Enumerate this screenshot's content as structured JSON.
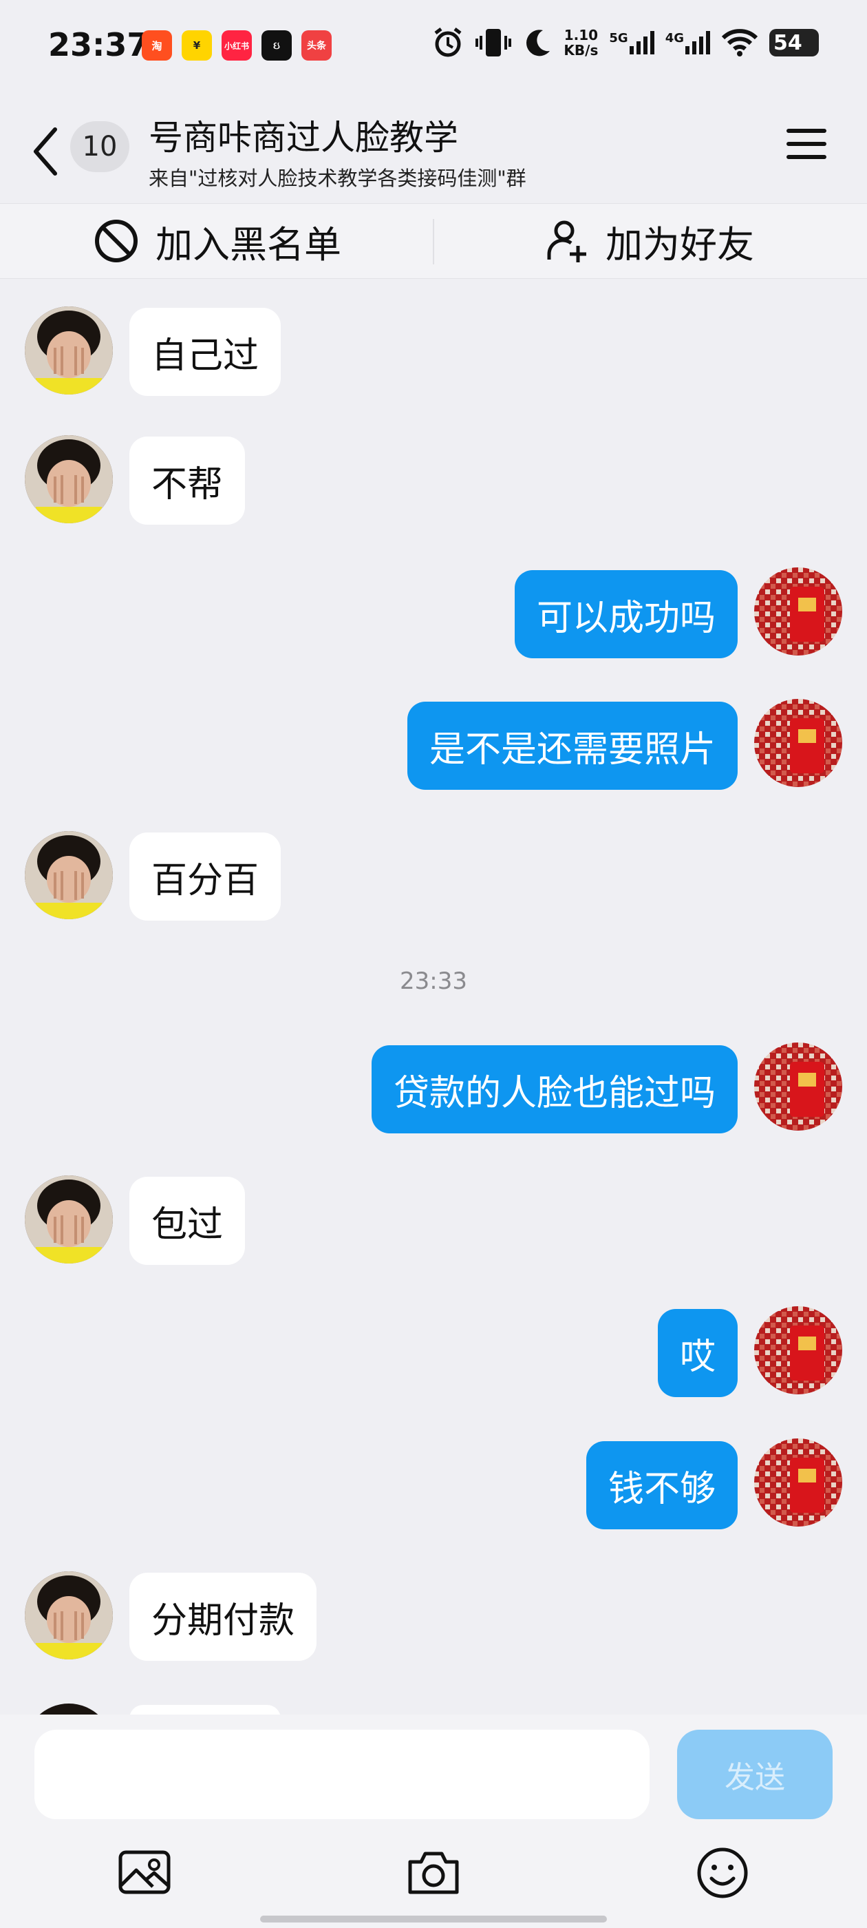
{
  "status_bar": {
    "time": "23:37",
    "apps": [
      {
        "icon": "taobao-icon",
        "text": "淘",
        "color": "#ff4f1f"
      },
      {
        "icon": "xianyu-icon",
        "text": "¥",
        "color": "#ffd400"
      },
      {
        "icon": "xiaohongshu-icon",
        "text": "小红书",
        "color": "#ff2442"
      },
      {
        "icon": "camera-app-icon",
        "text": "ઇ",
        "color": "#111111"
      },
      {
        "icon": "toutiao-icon",
        "text": "头条",
        "color": "#f04142"
      }
    ],
    "speed_value": "1.10",
    "speed_unit": "KB/s",
    "signal_1": "5G",
    "signal_2": "4G",
    "battery": "54"
  },
  "header": {
    "unread_count": "10",
    "title": "号商咔商过人脸教学",
    "subtitle": "来自\"过核对人脸技术教学各类接码佳测\"群"
  },
  "actions": {
    "block_label": "加入黑名单",
    "add_friend_label": "加为好友"
  },
  "messages": [
    {
      "side": "left",
      "text": "自己过"
    },
    {
      "side": "left",
      "text": "不帮"
    },
    {
      "side": "right",
      "text": "可以成功吗"
    },
    {
      "side": "right",
      "text": "是不是还需要照片"
    },
    {
      "side": "left",
      "text": "百分百"
    },
    {
      "side": "time",
      "text": "23:33"
    },
    {
      "side": "right",
      "text": "贷款的人脸也能过吗"
    },
    {
      "side": "left",
      "text": "包过"
    },
    {
      "side": "right",
      "text": "哎"
    },
    {
      "side": "right",
      "text": "钱不够"
    },
    {
      "side": "left",
      "text": "分期付款"
    }
  ],
  "input": {
    "placeholder": "",
    "send_label": "发送"
  },
  "colors": {
    "accent": "#0e96f0",
    "send_disabled": "#8ccbf6",
    "background": "#efeff3"
  }
}
